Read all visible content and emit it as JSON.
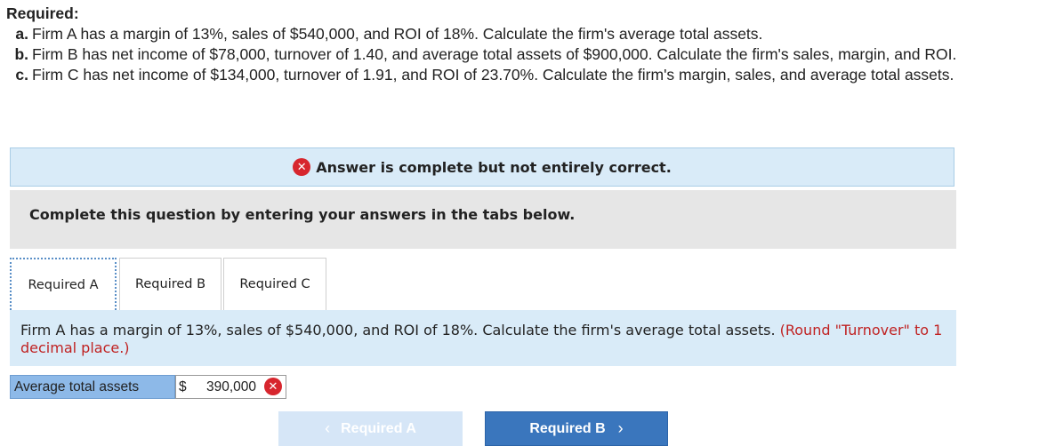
{
  "requirements": {
    "title": "Required:",
    "items": [
      {
        "letter": "a.",
        "text": "Firm A has a margin of 13%, sales of $540,000, and ROI of 18%. Calculate the firm's average total assets."
      },
      {
        "letter": "b.",
        "text": "Firm B has net income of $78,000, turnover of 1.40, and average total assets of $900,000. Calculate the firm's sales, margin, and ROI."
      },
      {
        "letter": "c.",
        "text": "Firm C has net income of $134,000, turnover of 1.91, and ROI of 23.70%. Calculate the firm's margin, sales, and average total assets."
      }
    ]
  },
  "alert": {
    "icon": "x-circle-icon",
    "message": "Answer is complete but not entirely correct."
  },
  "instruction": "Complete this question by entering your answers in the tabs below.",
  "tabs": [
    {
      "label": "Required A",
      "active": true
    },
    {
      "label": "Required B",
      "active": false
    },
    {
      "label": "Required C",
      "active": false
    }
  ],
  "panel": {
    "question": "Firm A has a margin of 13%, sales of $540,000, and ROI of 18%. Calculate the firm's average total assets.",
    "hint": "(Round \"Turnover\" to 1 decimal place.)"
  },
  "answer": {
    "label": "Average total assets",
    "currency": "$",
    "value": "390,000",
    "status_icon": "x-circle-icon"
  },
  "nav": {
    "prev_label": "Required A",
    "next_label": "Required B",
    "prev_icon": "chevron-left-icon",
    "next_icon": "chevron-right-icon"
  },
  "colors": {
    "error": "#d7262e",
    "alert_bg": "#d9ebf8",
    "button": "#3a76bd",
    "hint": "#c02222"
  }
}
